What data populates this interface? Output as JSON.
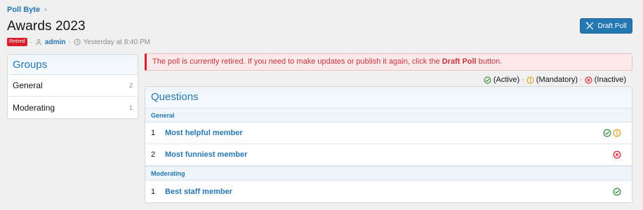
{
  "breadcrumb": {
    "label": "Poll Byte"
  },
  "page": {
    "title": "Awards 2023"
  },
  "meta": {
    "status_badge": "Retired",
    "author": "admin",
    "timestamp": "Yesterday at 8:40 PM"
  },
  "actions": {
    "draft_poll_label": "Draft Poll"
  },
  "notice": {
    "text_before": "The poll is currently retired. If you need to make updates or publish it again, click the ",
    "emphasis": "Draft Poll",
    "text_after": " button."
  },
  "legend": {
    "active": "(Active)",
    "mandatory": "(Mandatory)",
    "inactive": "(Inactive)"
  },
  "sidebar": {
    "title": "Groups",
    "items": [
      {
        "label": "General",
        "count": "2"
      },
      {
        "label": "Moderating",
        "count": "1"
      }
    ]
  },
  "questions": {
    "title": "Questions",
    "groups": [
      {
        "label": "General",
        "items": [
          {
            "num": "1",
            "title": "Most helpful member",
            "icons": [
              "active-icon",
              "mandatory-icon"
            ]
          },
          {
            "num": "2",
            "title": "Most funniest member",
            "icons": [
              "inactive-icon"
            ]
          }
        ]
      },
      {
        "label": "Moderating",
        "items": [
          {
            "num": "1",
            "title": "Best staff member",
            "icons": [
              "active-icon"
            ]
          }
        ]
      }
    ]
  },
  "colors": {
    "accent": "#2577b1",
    "active": "#2e8b3a",
    "mandatory": "#e59c16",
    "inactive": "#d8202c",
    "notice_bg": "#fde9e9"
  }
}
